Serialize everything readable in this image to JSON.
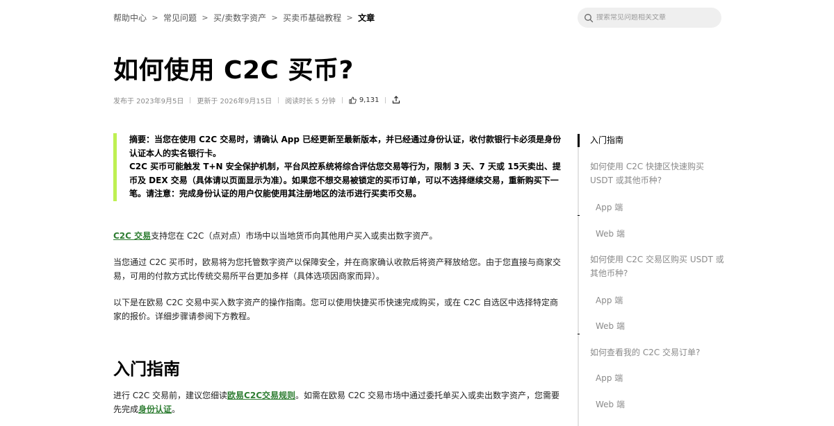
{
  "breadcrumb": {
    "items": [
      "帮助中心",
      "常见问题",
      "买/卖数字资产",
      "买卖币基础教程"
    ],
    "current": "文章"
  },
  "search": {
    "placeholder": "搜索常见问题相关文章"
  },
  "article": {
    "title": "如何使用 C2C 买币?",
    "meta": {
      "published": "发布于 2023年9月5日",
      "updated": "更新于 2026年9月15日",
      "read_time": "阅读时长 5 分钟",
      "likes": "9,131"
    },
    "summary": {
      "line1": "摘要：当您在使用 C2C 交易时，请确认 App 已经更新至最新版本，并已经通过身份认证，收付款银行卡必须是身份认证本人的实名银行卡。",
      "line2": "C2C 买币可能触发 T+N 安全保护机制，平台风控系统将综合评估您交易等行为，限制 3 天、7 天或 15天卖出、提币及 DEX 交易（具体请以页面显示为准）。如果您不想交易被锁定的买币订单，可以不选择继续交易，重新购买下一笔。请注意：完成身份认证的用户仅能使用其注册地区的法币进行买卖币交易。"
    },
    "p1": {
      "link": "C2C 交易",
      "text": "支持您在 C2C（点对点）市场中以当地货币向其他用户买入或卖出数字资产。"
    },
    "p2": "当您通过 C2C 买币时，欧易将为您托管数字资产以保障安全，并在商家确认收款后将资产释放给您。由于您直接与商家交易，可用的付款方式比传统交易所平台更加多样（具体选项因商家而异）。",
    "p3": "以下是在欧易 C2C 交易中买入数字资产的操作指南。您可以使用快捷买币快速完成购买，或在 C2C 自选区中选择特定商家的报价。详细步骤请参阅下方教程。",
    "h2": "入门指南",
    "p4": {
      "before": "进行 C2C 交易前，建议您细读",
      "link1": "欧易C2C交易规则",
      "middle": "。如需在欧易 C2C 交易市场中通过委托单买入或卖出数字资产，您需要先完成",
      "link2": "身份认证",
      "after": "。"
    }
  },
  "toc": {
    "items": [
      {
        "label": "入门指南"
      },
      {
        "label": "如何使用 C2C 快捷区快速购买 USDT 或其他币种?"
      },
      {
        "label": "App 端"
      },
      {
        "label": "Web 端"
      },
      {
        "label": "如何使用 C2C 交易区购买 USDT 或其他币种?"
      },
      {
        "label": "App 端"
      },
      {
        "label": "Web 端"
      },
      {
        "label": "如何查看我的 C2C 交易订单?"
      },
      {
        "label": "App 端"
      },
      {
        "label": "Web 端"
      }
    ]
  },
  "colors": {
    "accent_lime": "#bef052",
    "link_green": "#2e7d32",
    "text_muted": "#8a8a8a"
  }
}
